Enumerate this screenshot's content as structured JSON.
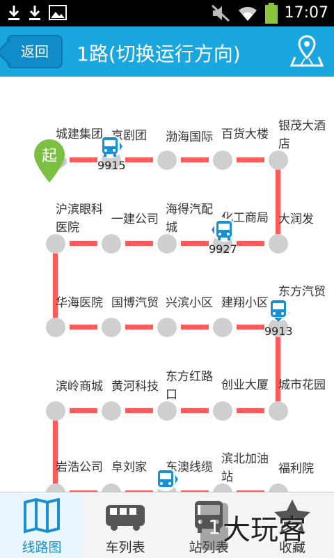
{
  "status_bar": {
    "time": "17:07"
  },
  "header": {
    "back_label": "返回",
    "title": "1路(切换运行方向)"
  },
  "start_marker": {
    "label": "起"
  },
  "rows": [
    [
      "城建集团",
      "京剧团",
      "渤海国际",
      "百货大楼",
      "银茂大酒店"
    ],
    [
      "沪滨眼科医院",
      "一建公司",
      "海得汽配城",
      "化工商局",
      "大润发"
    ],
    [
      "华海医院",
      "国博汽贸",
      "兴滨小区",
      "建翔小区",
      "东方汽贸城"
    ],
    [
      "滨岭商城",
      "黄河科技",
      "东方红路口",
      "创业大厦",
      "城市花园"
    ],
    [
      "岩浩公司",
      "阜刘家",
      "东澳线缆",
      "滨北加油站",
      "福利院"
    ]
  ],
  "buses": [
    {
      "number": "9915"
    },
    {
      "number": "9927"
    },
    {
      "number": "9913"
    },
    {
      "number": ""
    }
  ],
  "tabs": [
    {
      "label": "线路图"
    },
    {
      "label": "车列表"
    },
    {
      "label": "站列表"
    },
    {
      "label": "收藏"
    }
  ],
  "watermark": "大玩客",
  "colors": {
    "accent": "#1aa7e0",
    "route": "#ff5a5a",
    "stop": "#cfcfcf"
  }
}
